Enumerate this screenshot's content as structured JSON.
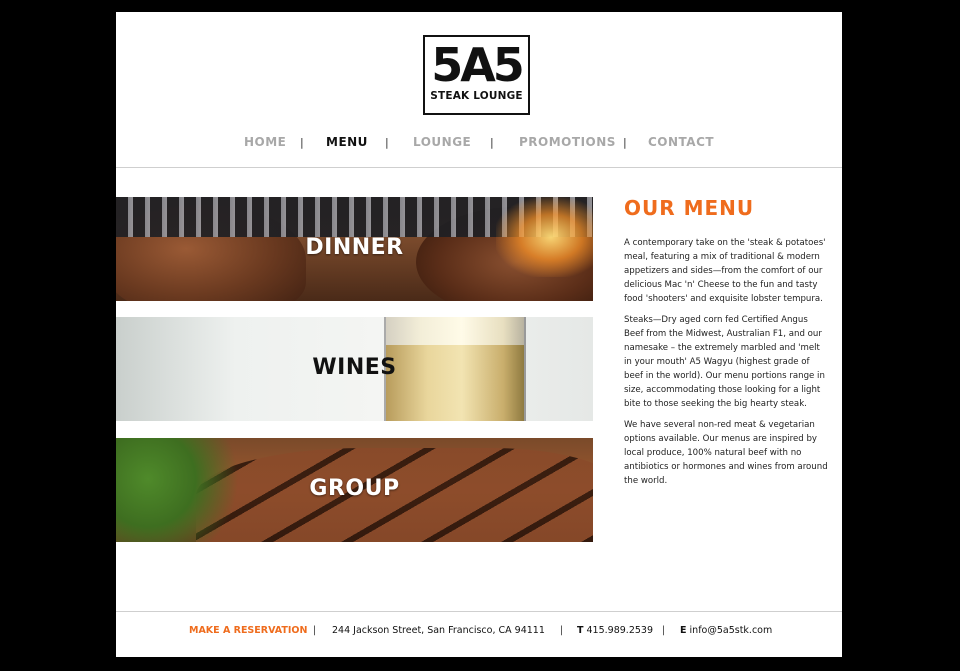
{
  "brand": {
    "logo_main": "5A5",
    "logo_sub": "STEAK LOUNGE"
  },
  "nav": {
    "items": [
      {
        "label": "HOME",
        "active": false
      },
      {
        "label": "MENU",
        "active": true
      },
      {
        "label": "LOUNGE",
        "active": false
      },
      {
        "label": "PROMOTIONS",
        "active": false
      },
      {
        "label": "CONTACT",
        "active": false
      }
    ],
    "separator": "|"
  },
  "banners": {
    "dinner": "DINNER",
    "wines": "WINES",
    "group": "GROUP"
  },
  "content": {
    "title": "OUR MENU",
    "paragraphs": [
      "A contemporary take on the 'steak & potatoes' meal, featuring a mix of traditional & modern appetizers and sides—from the comfort of our delicious Mac 'n' Cheese to the fun and tasty food 'shooters' and exquisite lobster tempura.",
      "Steaks—Dry aged corn fed Certified Angus Beef from the Midwest, Australian F1, and our namesake – the extremely marbled and 'melt in your mouth' A5 Wagyu (highest grade of beef in the world). Our menu portions range in size, accommodating those looking for a light bite to those seeking the big hearty steak.",
      "We have several non-red meat & vegetarian options available. Our menus are inspired by local produce, 100% natural beef with no antibiotics or hormones and wines from around the world."
    ]
  },
  "footer": {
    "reservation": "MAKE A RESERVATION",
    "address": "244 Jackson Street, San Francisco, CA 94111",
    "phone_prefix": "T",
    "phone": "415.989.2539",
    "email_prefix": "E",
    "email": "info@5a5stk.com",
    "separator": "|"
  },
  "colors": {
    "accent": "#ef6c1d",
    "nav_inactive": "#a8a8a8",
    "nav_active": "#111111"
  }
}
